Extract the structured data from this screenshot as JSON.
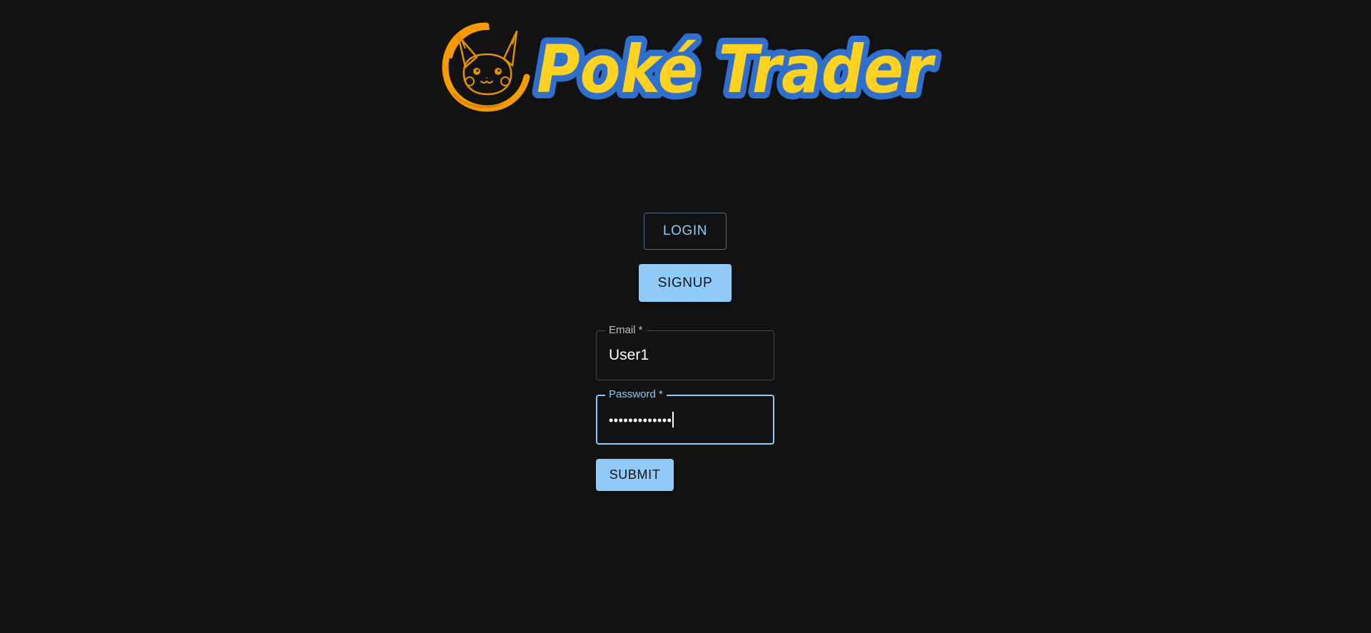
{
  "logo": {
    "wordmark": "Poké Trader",
    "mascot_icon": "pikachu-face-icon"
  },
  "auth_tabs": {
    "login_label": "LOGIN",
    "signup_label": "SIGNUP"
  },
  "form": {
    "email": {
      "label": "Email *",
      "value": "User1"
    },
    "password": {
      "label": "Password *",
      "masked_value": "•••••••••••••"
    },
    "submit_label": "SUBMIT"
  },
  "colors": {
    "background": "#121212",
    "accent": "#90caf9",
    "logo_yellow": "#ffd21f",
    "logo_blue": "#2f6fce",
    "badge_orange": "#f59b00"
  }
}
